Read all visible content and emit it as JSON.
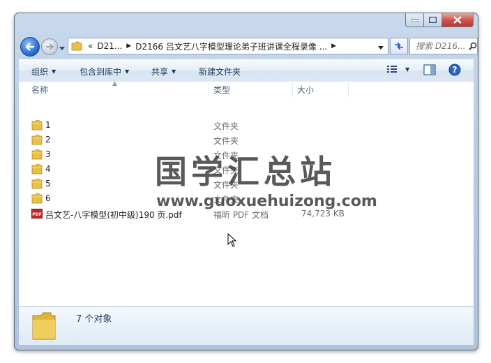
{
  "window": {
    "caption_buttons": [
      "minimize",
      "maximize",
      "close"
    ]
  },
  "address": {
    "back_icon": "back-arrow-icon",
    "forward_icon": "forward-arrow-icon",
    "overflow": "«",
    "crumbs": [
      "D21...",
      "D2166 吕文艺八字模型理论弟子班讲课全程录像 ..."
    ],
    "search_placeholder": "搜索 D216..."
  },
  "toolbar": {
    "organize": "组织",
    "include_in_library": "包含到库中",
    "share": "共享",
    "new_folder": "新建文件夹"
  },
  "columns": {
    "name": "名称",
    "type": "类型",
    "size": "大小"
  },
  "files": [
    {
      "name": "1",
      "type": "文件夹",
      "size": "",
      "icon": "folder-icon"
    },
    {
      "name": "2",
      "type": "文件夹",
      "size": "",
      "icon": "folder-icon"
    },
    {
      "name": "3",
      "type": "文件夹",
      "size": "",
      "icon": "folder-icon"
    },
    {
      "name": "4",
      "type": "文件夹",
      "size": "",
      "icon": "folder-icon"
    },
    {
      "name": "5",
      "type": "文件夹",
      "size": "",
      "icon": "folder-icon"
    },
    {
      "name": "6",
      "type": "文件夹",
      "size": "",
      "icon": "folder-icon"
    },
    {
      "name": "吕文艺-八字模型(初中级)190 页.pdf",
      "type": "福昕 PDF 文档",
      "size": "74,723 KB",
      "icon": "pdf-icon"
    }
  ],
  "details": {
    "count": "7 个对象"
  },
  "watermark": {
    "text": "国学汇总站",
    "url": "www.guoxuehuizong.com"
  },
  "colors": {
    "frame": "#b8cde6",
    "toolbar_text": "#1e395b",
    "folder": "#e8c04a",
    "pdf": "#c0282d"
  }
}
